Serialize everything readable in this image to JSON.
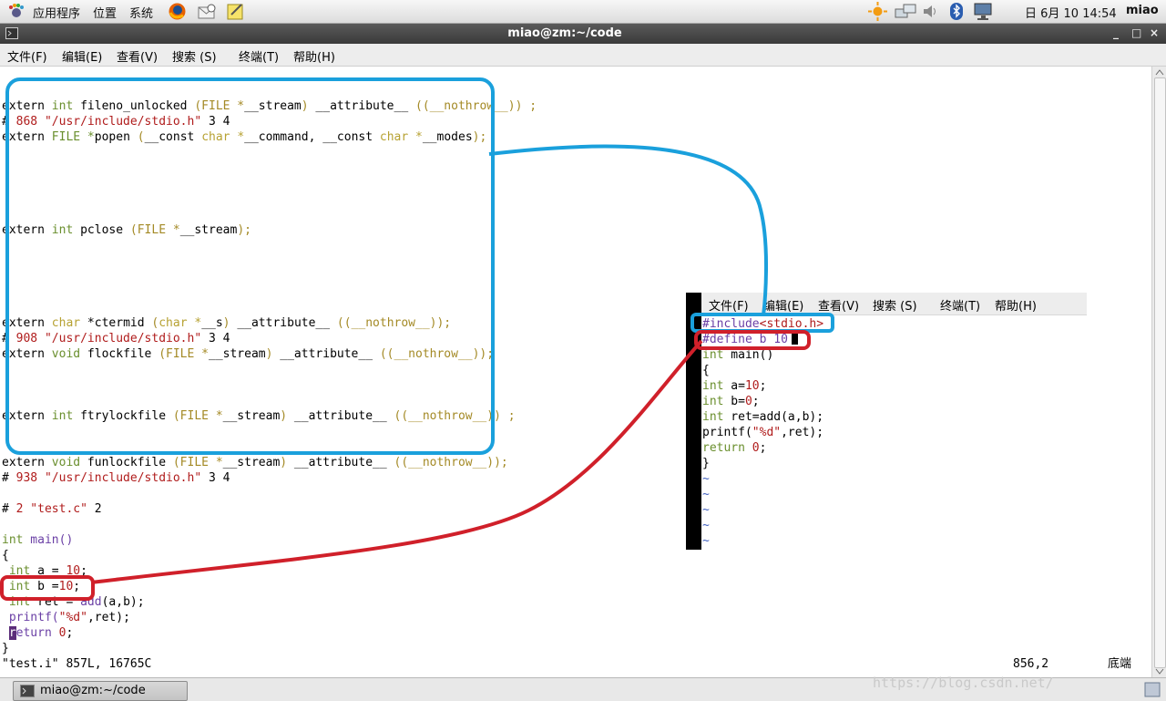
{
  "top_panel": {
    "menus": [
      "应用程序",
      "位置",
      "系统"
    ],
    "clock": "日 6月 10 14:54",
    "user": "miao",
    "icons": [
      "foot-icon",
      "firefox-icon",
      "mail-icon",
      "notes-icon",
      "weather-icon",
      "network-icon",
      "volume-icon",
      "bluetooth-icon",
      "display-icon"
    ]
  },
  "window": {
    "title": "miao@zm:~/code",
    "controls": [
      "_",
      "□",
      "×"
    ]
  },
  "menubar": [
    "文件(F)",
    "编辑(E)",
    "查看(V)",
    "搜索 (S)",
    "终端(T)",
    "帮助(H)"
  ],
  "code": {
    "l1a": "extern ",
    "l1b": "int",
    "l1c": " fileno_unlocked ",
    "l1d": "(FILE *",
    "l1e": "__stream",
    "l1f": ")",
    "l1g": " __attribute__ ",
    "l1h": "((__nothrow__))",
    "l1i": " ;",
    "l2a": "# ",
    "l2b": "868",
    "l2c": " \"/usr/include/stdio.h\"",
    "l2d": " 3 4",
    "l3a": "extern ",
    "l3b": "FILE *",
    "l3c": "popen ",
    "l3d": "(",
    "l3e": "__const ",
    "l3f": "char",
    "l3g": " *",
    "l3h": "__command",
    "l3i": ", ",
    "l3j": "__const ",
    "l3k": "char",
    "l3l": " *",
    "l3m": "__modes",
    "l3n": ");",
    "l4a": "extern ",
    "l4b": "int",
    "l4c": " pclose ",
    "l4d": "(FILE *",
    "l4e": "__stream",
    "l4f": ");",
    "l5a": "extern ",
    "l5b": "char",
    "l5c": " *ctermid ",
    "l5d": "(",
    "l5e": "char",
    "l5f": " *",
    "l5g": "__s",
    "l5h": ")",
    "l5i": " __attribute__ ",
    "l5j": "((__nothrow__));",
    "l6a": "# ",
    "l6b": "908",
    "l6c": " \"/usr/include/stdio.h\"",
    "l6d": " 3 4",
    "l7a": "extern ",
    "l7b": "void",
    "l7c": " flockfile ",
    "l7d": "(FILE *",
    "l7e": "__stream",
    "l7f": ")",
    "l7g": " __attribute__ ",
    "l7h": "((__nothrow__))",
    "l7i": ";",
    "l8a": "extern ",
    "l8b": "int",
    "l8c": " ftrylockfile ",
    "l8d": "(FILE *",
    "l8e": "__stream",
    "l8f": ")",
    "l8g": " __attribute__ ",
    "l8h": "((__nothrow__))",
    "l8i": " ;",
    "l9a": "extern ",
    "l9b": "void",
    "l9c": " funlockfile ",
    "l9d": "(FILE *",
    "l9e": "__stream",
    "l9f": ")",
    "l9g": " __attribute__ ",
    "l9h": "((__nothrow__))",
    "l9i": ";",
    "l10a": "# ",
    "l10b": "938",
    "l10c": " \"/usr/include/stdio.h\"",
    "l10d": " 3 4",
    "l11a": "# ",
    "l11b": "2",
    "l11c": " \"test.c\"",
    "l11d": " 2",
    "l12a": "int",
    "l12b": " main",
    "l12c": "()",
    "l13": "{",
    "l14a": " ",
    "l14b": "int",
    "l14c": " a = ",
    "l14d": "10",
    "l14e": ";",
    "l15a": " ",
    "l15b": "int",
    "l15c": " b =",
    "l15d": "10",
    "l15e": ";",
    "l16a": " ",
    "l16b": "int",
    "l16c": " ret = ",
    "l16d": "add",
    "l16e": "(a,b);",
    "l17a": " printf",
    "l17b": "(",
    "l17c": "\"%d\"",
    "l17d": ",ret);",
    "l18a": " ",
    "l18b": "r",
    "l18c": "eturn ",
    "l18d": "0",
    "l18e": ";",
    "l19": "}"
  },
  "status": {
    "left": "\"test.i\" 857L, 16765C",
    "pos": "856,2",
    "where": "底端"
  },
  "inset": {
    "menu": [
      "文件(F)",
      "编辑(E)",
      "查看(V)",
      "搜索 (S)",
      "终端(T)",
      "帮助(H)"
    ],
    "i1a": "#include",
    "i1b": "<stdio.h>",
    "i2a": "#define",
    "i2b": " b 10",
    "i3a": "int",
    "i3b": " main()",
    "i4": "{",
    "i5a": "int",
    "i5b": " a=",
    "i5c": "10",
    "i5d": ";",
    "i6a": "int",
    "i6b": " b=",
    "i6c": "0",
    "i6d": ";",
    "i7a": "int",
    "i7b": " ret=add(a,b);",
    "i8a": "printf(",
    "i8b": "\"%d\"",
    "i8c": ",ret);",
    "i9a": "return ",
    "i9b": "0",
    "i9c": ";",
    "i10": "}",
    "tilde": "~"
  },
  "taskbar": {
    "button": "miao@zm:~/code"
  },
  "watermark": "https://blog.csdn.net/"
}
